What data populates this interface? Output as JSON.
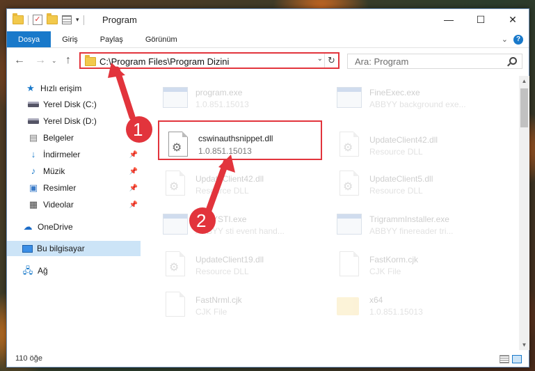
{
  "window": {
    "title": "Program",
    "controls": {
      "minimize": "—",
      "maximize": "☐",
      "close": "✕"
    }
  },
  "ribbon": {
    "tabs": [
      {
        "label": "Dosya",
        "active": true
      },
      {
        "label": "Giriş"
      },
      {
        "label": "Paylaş"
      },
      {
        "label": "Görünüm"
      }
    ],
    "help": "?"
  },
  "navigation": {
    "back": "←",
    "forward": "→",
    "up": "↑",
    "address": "C:\\Program Files\\Program Dizini",
    "search_placeholder": "Ara: Program"
  },
  "sidebar": {
    "items": [
      {
        "label": "Hızlı erişim"
      },
      {
        "label": "Yerel Disk (C:)"
      },
      {
        "label": "Yerel Disk (D:)"
      },
      {
        "label": "Belgeler"
      },
      {
        "label": "İndirmeler"
      },
      {
        "label": "Müzik"
      },
      {
        "label": "Resimler"
      },
      {
        "label": "Videolar"
      },
      {
        "label": "OneDrive"
      },
      {
        "label": "Bu bilgisayar",
        "selected": true
      },
      {
        "label": "Ağ"
      }
    ]
  },
  "files": [
    {
      "name": "program.exe",
      "sub": "1.0.851.15013",
      "icon": "exe-icon"
    },
    {
      "name": "FineExec.exe",
      "sub": "ABBYY background exe...",
      "icon": "exe-icon"
    },
    {
      "name": "cswinauthsnippet.dll",
      "sub": "1.0.851.15013",
      "icon": "dll-icon",
      "highlighted": true
    },
    {
      "name": "UpdateClient42.dll",
      "sub": "Resource DLL",
      "icon": "dll-icon"
    },
    {
      "name": "UpdateClient42.dll",
      "sub": "Resource DLL",
      "icon": "dll-icon"
    },
    {
      "name": "UpdateClient5.dll",
      "sub": "Resource DLL",
      "icon": "dll-icon"
    },
    {
      "name": "ABBYSTI.exe",
      "sub": "ABBYY sti event hand...",
      "icon": "exe-icon"
    },
    {
      "name": "TrigrammInstaller.exe",
      "sub": "ABBYY finereader tri...",
      "icon": "exe-icon"
    },
    {
      "name": "UpdateClient19.dll",
      "sub": "Resource DLL",
      "icon": "dll-icon"
    },
    {
      "name": "FastKorm.cjk",
      "sub": "CJK File",
      "icon": "file-icon"
    },
    {
      "name": "FastNrml.cjk",
      "sub": "CJK File",
      "icon": "file-icon"
    },
    {
      "name": "x64",
      "sub": "1.0.851.15013",
      "icon": "folder-icon"
    }
  ],
  "status": {
    "count": "110 öğe"
  },
  "annotations": {
    "step1": "1",
    "step2": "2",
    "color": "#e2343c"
  }
}
